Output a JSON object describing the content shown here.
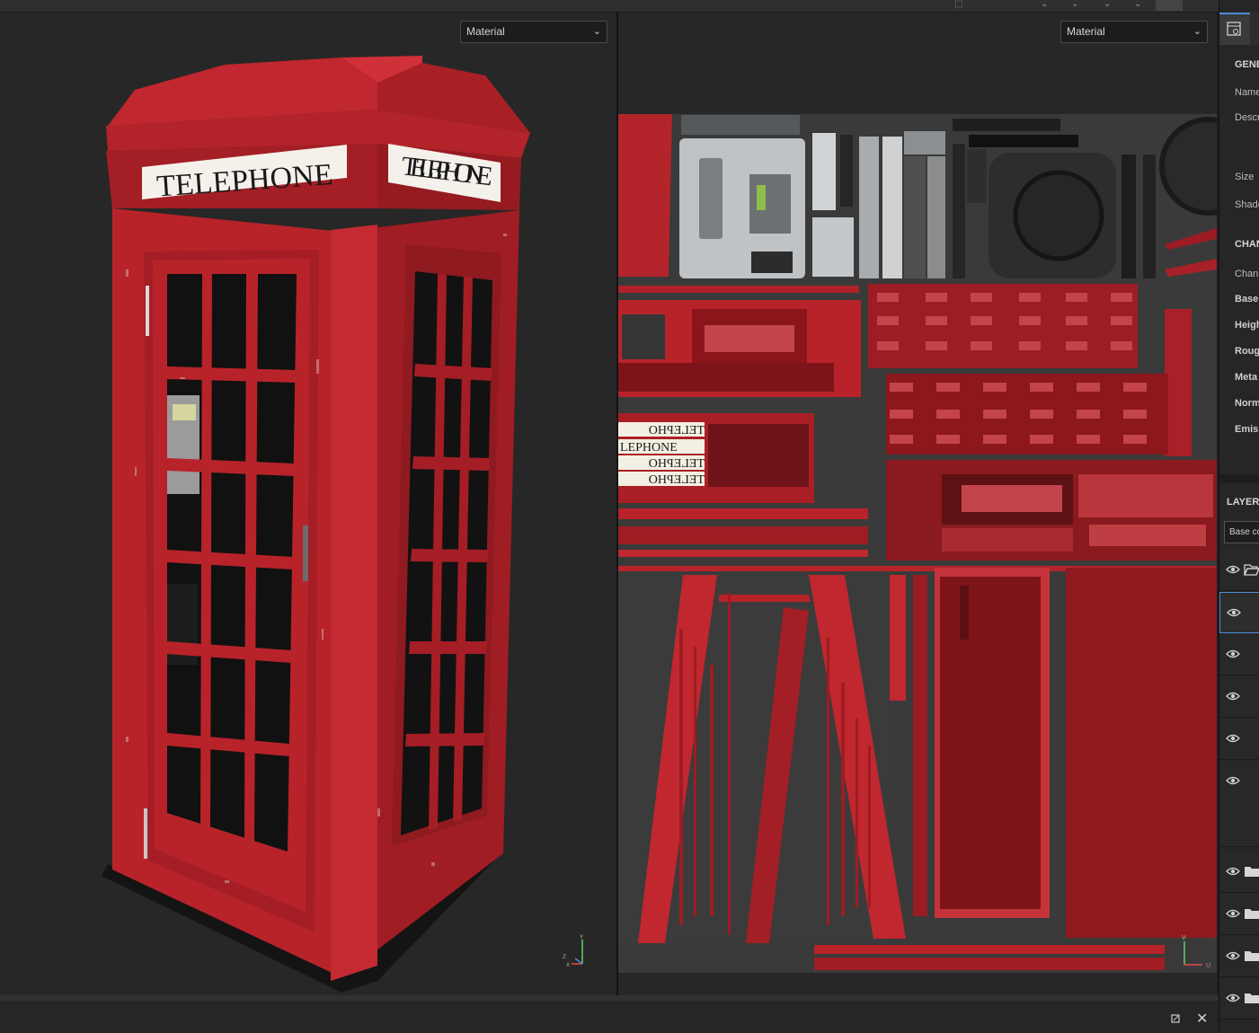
{
  "viewport_3d": {
    "mode_label": "Material",
    "sign_text": "TELEPHONE",
    "gizmo": {
      "y": "Y",
      "z": "Z",
      "x": "X"
    }
  },
  "viewport_2d": {
    "mode_label": "Material",
    "uv_signs": [
      "OHEЛЕТ",
      "LEPHONE",
      "OHEЛЕТ",
      "OHEЛЕТ"
    ],
    "uv_sign_texts": [
      "TELEPHO",
      "LEPHONE",
      "TELEPHO",
      "TELEPHO"
    ],
    "gizmo": {
      "v": "V",
      "u": "U"
    }
  },
  "right_panel": {
    "general_heading": "GENE",
    "fields": {
      "name": "Name",
      "description": "Descr",
      "size": "Size",
      "shader": "Shade"
    },
    "channels_heading": "CHAN",
    "channel_label": "Chann",
    "channels": [
      "Base",
      "Heigh",
      "Roug",
      "Meta",
      "Norm",
      "Emis"
    ],
    "layers_heading": "LAYERS",
    "layer_channel_select": "Base co"
  },
  "layers": [
    {
      "visible": true,
      "type": "folder-open"
    },
    {
      "visible": true,
      "type": "layer",
      "selected": true
    },
    {
      "visible": true,
      "type": "layer"
    },
    {
      "visible": true,
      "type": "layer"
    },
    {
      "visible": true,
      "type": "layer"
    },
    {
      "visible": true,
      "type": "layer"
    },
    {
      "visible": true,
      "type": "folder"
    },
    {
      "visible": true,
      "type": "folder"
    },
    {
      "visible": true,
      "type": "folder"
    },
    {
      "visible": true,
      "type": "folder"
    }
  ],
  "colors": {
    "booth_red": "#b8232a",
    "booth_dark": "#7d1418",
    "viewport_bg": "#272727",
    "accent": "#4d8fd6"
  }
}
